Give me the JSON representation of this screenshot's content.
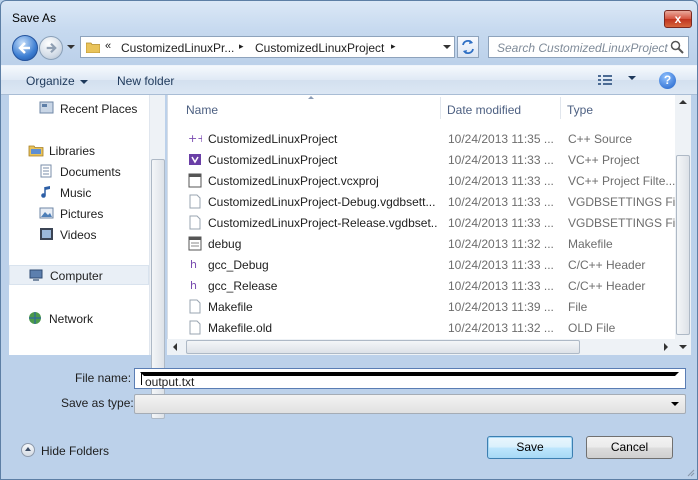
{
  "window": {
    "title": "Save As",
    "close_label": "x"
  },
  "address": {
    "crumb_overflow": "«",
    "crumbs": [
      "CustomizedLinuxPr...",
      "CustomizedLinuxProject"
    ],
    "separator": "▸"
  },
  "search": {
    "placeholder": "Search CustomizedLinuxProject"
  },
  "toolbar": {
    "organize": "Organize",
    "new_folder": "New folder",
    "help": "?"
  },
  "nav": {
    "items": [
      {
        "label": "Recent Places",
        "icon": "recent-places-icon"
      },
      {
        "label": "Libraries",
        "icon": "libraries-icon"
      },
      {
        "label": "Documents",
        "icon": "documents-icon"
      },
      {
        "label": "Music",
        "icon": "music-icon"
      },
      {
        "label": "Pictures",
        "icon": "pictures-icon"
      },
      {
        "label": "Videos",
        "icon": "videos-icon"
      },
      {
        "label": "Computer",
        "icon": "computer-icon"
      },
      {
        "label": "Network",
        "icon": "network-icon"
      }
    ]
  },
  "columns": {
    "name": "Name",
    "date": "Date modified",
    "type": "Type"
  },
  "files": [
    {
      "name": "CustomizedLinuxProject",
      "date": "10/24/2013 11:35 ...",
      "type": "C++ Source",
      "icon": "cpp-source-icon"
    },
    {
      "name": "CustomizedLinuxProject",
      "date": "10/24/2013 11:33 ...",
      "type": "VC++ Project",
      "icon": "vcproject-icon"
    },
    {
      "name": "CustomizedLinuxProject.vcxproj",
      "date": "10/24/2013 11:33 ...",
      "type": "VC++ Project Filte...",
      "icon": "project-filter-icon"
    },
    {
      "name": "CustomizedLinuxProject-Debug.vgdbsett...",
      "date": "10/24/2013 11:33 ...",
      "type": "VGDBSETTINGS File",
      "icon": "generic-file-icon"
    },
    {
      "name": "CustomizedLinuxProject-Release.vgdbset...",
      "date": "10/24/2013 11:33 ...",
      "type": "VGDBSETTINGS File",
      "icon": "generic-file-icon"
    },
    {
      "name": "debug",
      "date": "10/24/2013 11:32 ...",
      "type": "Makefile",
      "icon": "makefile-icon"
    },
    {
      "name": "gcc_Debug",
      "date": "10/24/2013 11:33 ...",
      "type": "C/C++ Header",
      "icon": "header-file-icon"
    },
    {
      "name": "gcc_Release",
      "date": "10/24/2013 11:33 ...",
      "type": "C/C++ Header",
      "icon": "header-file-icon"
    },
    {
      "name": "Makefile",
      "date": "10/24/2013 11:39 ...",
      "type": "File",
      "icon": "generic-file-icon"
    },
    {
      "name": "Makefile.old",
      "date": "10/24/2013 11:32 ...",
      "type": "OLD File",
      "icon": "generic-file-icon"
    }
  ],
  "form": {
    "file_name_label": "File name:",
    "file_name_value": "output.txt",
    "save_as_type_label": "Save as type:",
    "save_as_type_value": ""
  },
  "footer": {
    "hide_folders": "Hide Folders",
    "save": "Save",
    "cancel": "Cancel"
  }
}
